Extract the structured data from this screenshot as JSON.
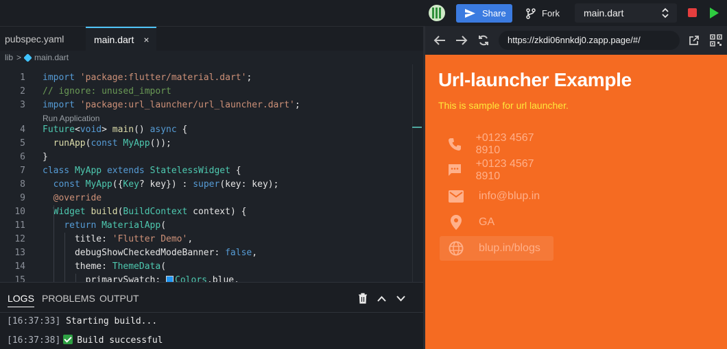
{
  "topbar": {
    "share_label": "Share",
    "fork_label": "Fork",
    "file_select_value": "main.dart"
  },
  "tabs": [
    {
      "label": "pubspec.yaml"
    },
    {
      "label": "main.dart",
      "close": "×"
    }
  ],
  "breadcrumb": {
    "folder": "lib",
    "sep": ">",
    "file": "main.dart"
  },
  "code_hint": "Run Application",
  "line_numbers": [
    "1",
    "2",
    "3",
    "4",
    "5",
    "6",
    "7",
    "8",
    "9",
    "10",
    "11",
    "12",
    "13",
    "14",
    "15"
  ],
  "panel": {
    "tabs": [
      "LOGS",
      "PROBLEMS",
      "OUTPUT"
    ],
    "logs": [
      {
        "time": "[16:37:33]",
        "text": "Starting build..."
      },
      {
        "time": "[16:37:38]",
        "text": "Build successful"
      }
    ]
  },
  "browser": {
    "url": "https://zkdi06nnkdj0.zapp.page/#/"
  },
  "preview": {
    "title": "Url-launcher Example",
    "subtitle": "This is sample for url launcher.",
    "items": [
      {
        "icon": "phone-icon",
        "label": "+0123 4567 8910"
      },
      {
        "icon": "sms-icon",
        "label": "+0123 4567 8910"
      },
      {
        "icon": "mail-icon",
        "label": "info@blup.in"
      },
      {
        "icon": "location-pin-icon",
        "label": "GA"
      },
      {
        "icon": "globe-icon",
        "label": "blup.in/blogs"
      }
    ]
  },
  "colors": {
    "accent": "#3b7be0",
    "preview_bg": "#f56b22",
    "subtitle": "#ffe83b",
    "item_text": "#ffb08a"
  }
}
